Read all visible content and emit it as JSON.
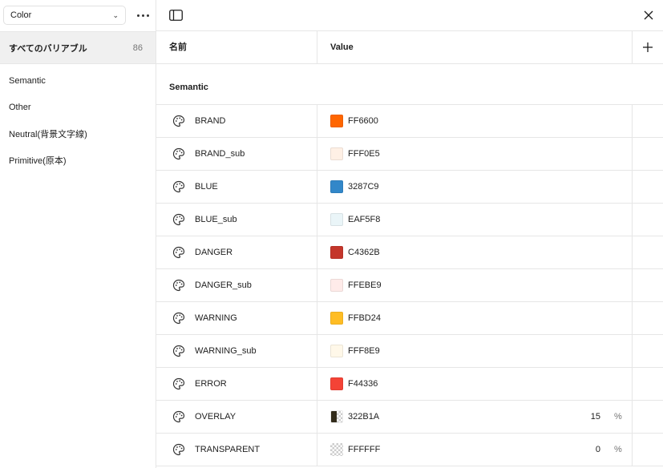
{
  "sidebar": {
    "collection": "Color",
    "all_variables": {
      "label": "すべてのバリアブル",
      "count": "86"
    },
    "groups": [
      "Semantic",
      "Other",
      "Neutral(背景文字線)",
      "Primitive(原本)"
    ]
  },
  "table": {
    "headers": {
      "name": "名前",
      "value": "Value"
    },
    "section": "Semantic",
    "rows": [
      {
        "name": "BRAND",
        "hex": "FF6600",
        "color": "#FF6600"
      },
      {
        "name": "BRAND_sub",
        "hex": "FFF0E5",
        "color": "#FFF0E5"
      },
      {
        "name": "BLUE",
        "hex": "3287C9",
        "color": "#3287C9"
      },
      {
        "name": "BLUE_sub",
        "hex": "EAF5F8",
        "color": "#EAF5F8"
      },
      {
        "name": "DANGER",
        "hex": "C4362B",
        "color": "#C4362B"
      },
      {
        "name": "DANGER_sub",
        "hex": "FFEBE9",
        "color": "#FFEBE9"
      },
      {
        "name": "WARNING",
        "hex": "FFBD24",
        "color": "#FFBD24"
      },
      {
        "name": "WARNING_sub",
        "hex": "FFF8E9",
        "color": "#FFF8E9"
      },
      {
        "name": "ERROR",
        "hex": "F44336",
        "color": "#F44336"
      },
      {
        "name": "OVERLAY",
        "hex": "322B1A",
        "color": "#322B1A",
        "alpha": "15",
        "alpha_unit": "%"
      },
      {
        "name": "TRANSPARENT",
        "hex": "FFFFFF",
        "color": "#FFFFFF",
        "alpha": "0",
        "alpha_unit": "%"
      }
    ]
  },
  "icons": {
    "collection_dropdown": "chevron-down-icon",
    "more": "more-icon",
    "panel_toggle": "sidebar-toggle-icon",
    "close": "close-icon",
    "add": "plus-icon",
    "variable": "palette-icon"
  }
}
